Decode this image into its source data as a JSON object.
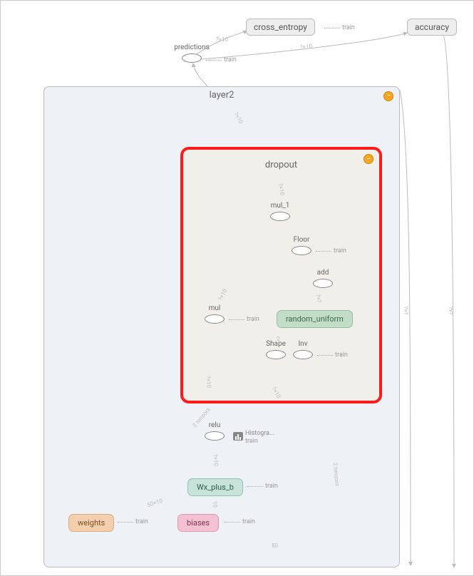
{
  "diagram": {
    "top_nodes": {
      "cross_entropy": "cross_entropy",
      "accuracy": "accuracy"
    },
    "predictions": {
      "label": "predictions",
      "train": "train"
    },
    "layer2": {
      "title": "layer2",
      "dropout": {
        "title": "dropout",
        "mul_1": {
          "label": "mul_1"
        },
        "floor": {
          "label": "Floor",
          "train": "train"
        },
        "add": {
          "label": "add"
        },
        "mul": {
          "label": "mul",
          "train": "train"
        },
        "random_uniform": "random_uniform",
        "shape": {
          "label": "Shape"
        },
        "inv": {
          "label": "Inv",
          "train": "train"
        }
      },
      "relu": {
        "label": "relu",
        "histo": "Histogra...",
        "histo_train": "train"
      },
      "wx_plus_b": {
        "label": "Wx_plus_b",
        "train": "train"
      },
      "weights": {
        "label": "weights",
        "train": "train"
      },
      "biases": {
        "label": "biases",
        "train": "train"
      }
    },
    "edge_labels": {
      "pred_to_ce": "?×10",
      "pred_to_acc": "?×10",
      "layer2_to_pred": "?×10",
      "dropout_to_out": "?×10",
      "mul1_out": "?×10",
      "relu_out": "?×10",
      "wx_out": "?×10",
      "add_in": "?×?",
      "mul_in": "?",
      "mul_to_mul1": "?×10",
      "shape_out": "2",
      "relu_dim": "50×10",
      "gradients": "2 tensors",
      "side_edge": "?×?",
      "biases_dim": "10",
      "weights_dim": "50"
    }
  }
}
